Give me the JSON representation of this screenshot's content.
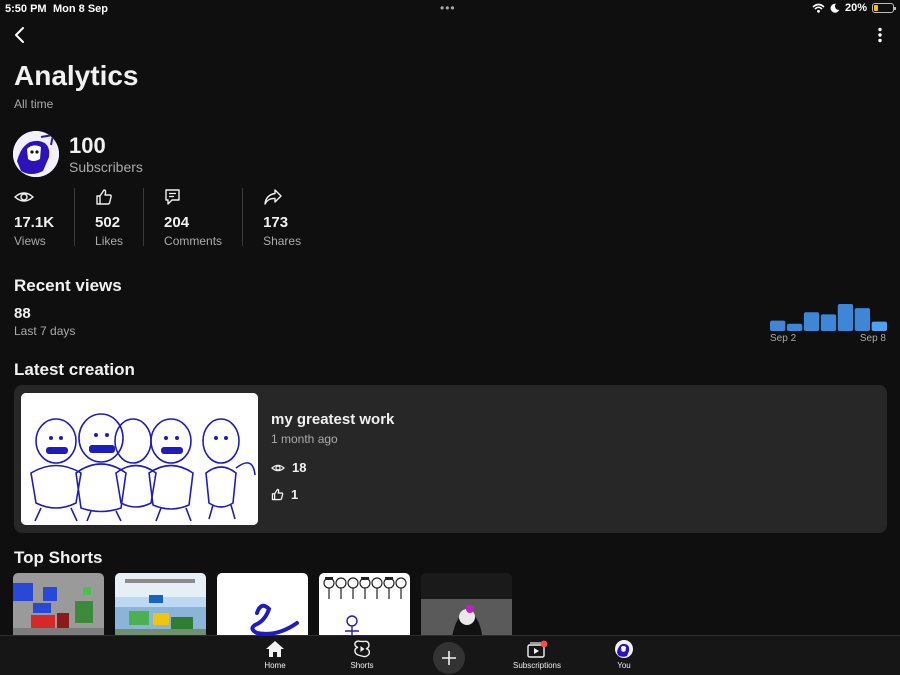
{
  "status_bar": {
    "time": "5:50 PM",
    "date": "Mon 8 Sep",
    "battery": "20%",
    "battery_level": 0.2,
    "battery_color": "#f5c400"
  },
  "header": {
    "back_icon": "chevron-left-icon",
    "more_icon": "more-vert-icon",
    "title": "Analytics",
    "period": "All time"
  },
  "channel": {
    "subscribers": "100",
    "subscribers_label": "Subscribers"
  },
  "stats": [
    {
      "icon": "eye-icon",
      "value": "17.1K",
      "label": "Views"
    },
    {
      "icon": "thumb-up-icon",
      "value": "502",
      "label": "Likes"
    },
    {
      "icon": "comment-icon",
      "value": "204",
      "label": "Comments"
    },
    {
      "icon": "share-icon",
      "value": "173",
      "label": "Shares"
    }
  ],
  "recent_views": {
    "title": "Recent views",
    "value": "88",
    "period": "Last 7 days",
    "start_label": "Sep 2",
    "end_label": "Sep 8"
  },
  "chart_data": {
    "type": "bar",
    "categories": [
      "Sep 2",
      "Sep 3",
      "Sep 4",
      "Sep 5",
      "Sep 6",
      "Sep 7",
      "Sep 8"
    ],
    "values": [
      10,
      7,
      18,
      16,
      26,
      22,
      9
    ],
    "colors": {
      "past": "#3e86d6",
      "today": "#4ea1f3"
    },
    "xlabel": "",
    "ylabel": ""
  },
  "latest_creation": {
    "section_title": "Latest creation",
    "title": "my greatest work",
    "age": "1 month ago",
    "views": "18",
    "likes": "1"
  },
  "top_shorts": {
    "title": "Top Shorts"
  },
  "tab_bar": {
    "home": "Home",
    "shorts": "Shorts",
    "subscriptions": "Subscriptions",
    "you": "You",
    "notification_color": "#ff4e45"
  }
}
